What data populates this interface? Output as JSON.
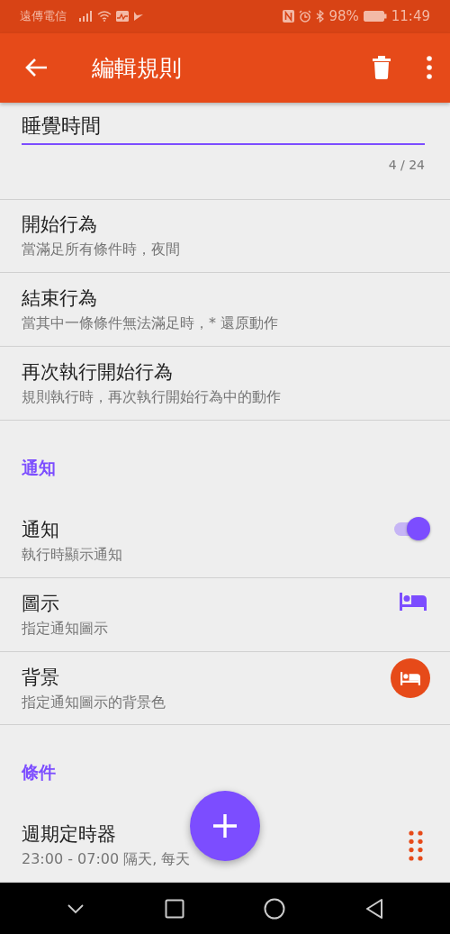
{
  "status_bar": {
    "carrier": "遠傳電信",
    "battery": "98%",
    "time": "11:49"
  },
  "app_bar": {
    "title": "編輯規則"
  },
  "name_field": {
    "value": "睡覺時間",
    "counter": "4 / 24"
  },
  "actions": [
    {
      "title": "開始行為",
      "subtitle": "當滿足所有條件時，夜間"
    },
    {
      "title": "結束行為",
      "subtitle": "當其中一條條件無法滿足時，* 還原動作"
    },
    {
      "title": "再次執行開始行為",
      "subtitle": "規則執行時，再次執行開始行為中的動作"
    }
  ],
  "sections": [
    {
      "header": "通知",
      "rows": [
        {
          "kind": "toggle",
          "title": "通知",
          "subtitle": "執行時顯示通知",
          "on": true
        },
        {
          "kind": "icon",
          "title": "圖示",
          "subtitle": "指定通知圖示"
        },
        {
          "kind": "color",
          "title": "背景",
          "subtitle": "指定通知圖示的背景色"
        }
      ]
    },
    {
      "header": "條件",
      "rows": [
        {
          "kind": "drag",
          "title": "週期定時器",
          "subtitle": "23:00 - 07:00 隔天, 每天"
        }
      ]
    }
  ]
}
